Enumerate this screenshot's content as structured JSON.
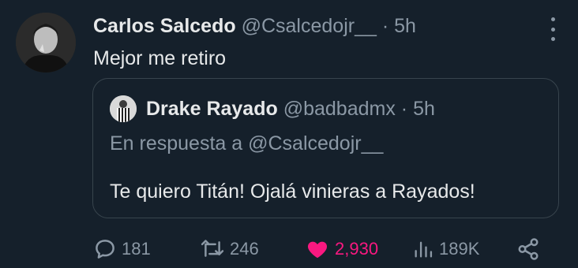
{
  "tweet": {
    "author_name": "Carlos Salcedo",
    "author_handle": "@Csalcedojr__",
    "separator": "·",
    "time": "5h",
    "text": "Mejor me retiro"
  },
  "quote": {
    "author_name": "Drake Rayado",
    "author_handle": "@badbadmx",
    "separator": "·",
    "time": "5h",
    "reply_to": "En respuesta a @Csalcedojr__",
    "text": "Te quiero Titán! Ojalá vinieras a Rayados!"
  },
  "actions": {
    "replies": "181",
    "retweets": "246",
    "likes": "2,930",
    "views": "189K"
  },
  "icons": {
    "more": "more-vertical-icon",
    "reply": "reply-icon",
    "retweet": "retweet-icon",
    "like": "heart-icon",
    "views": "views-icon",
    "share": "share-icon"
  },
  "colors": {
    "background": "#15202b",
    "text": "#e7e9ea",
    "muted": "#8b98a5",
    "like": "#f91880",
    "border": "#38444d"
  }
}
